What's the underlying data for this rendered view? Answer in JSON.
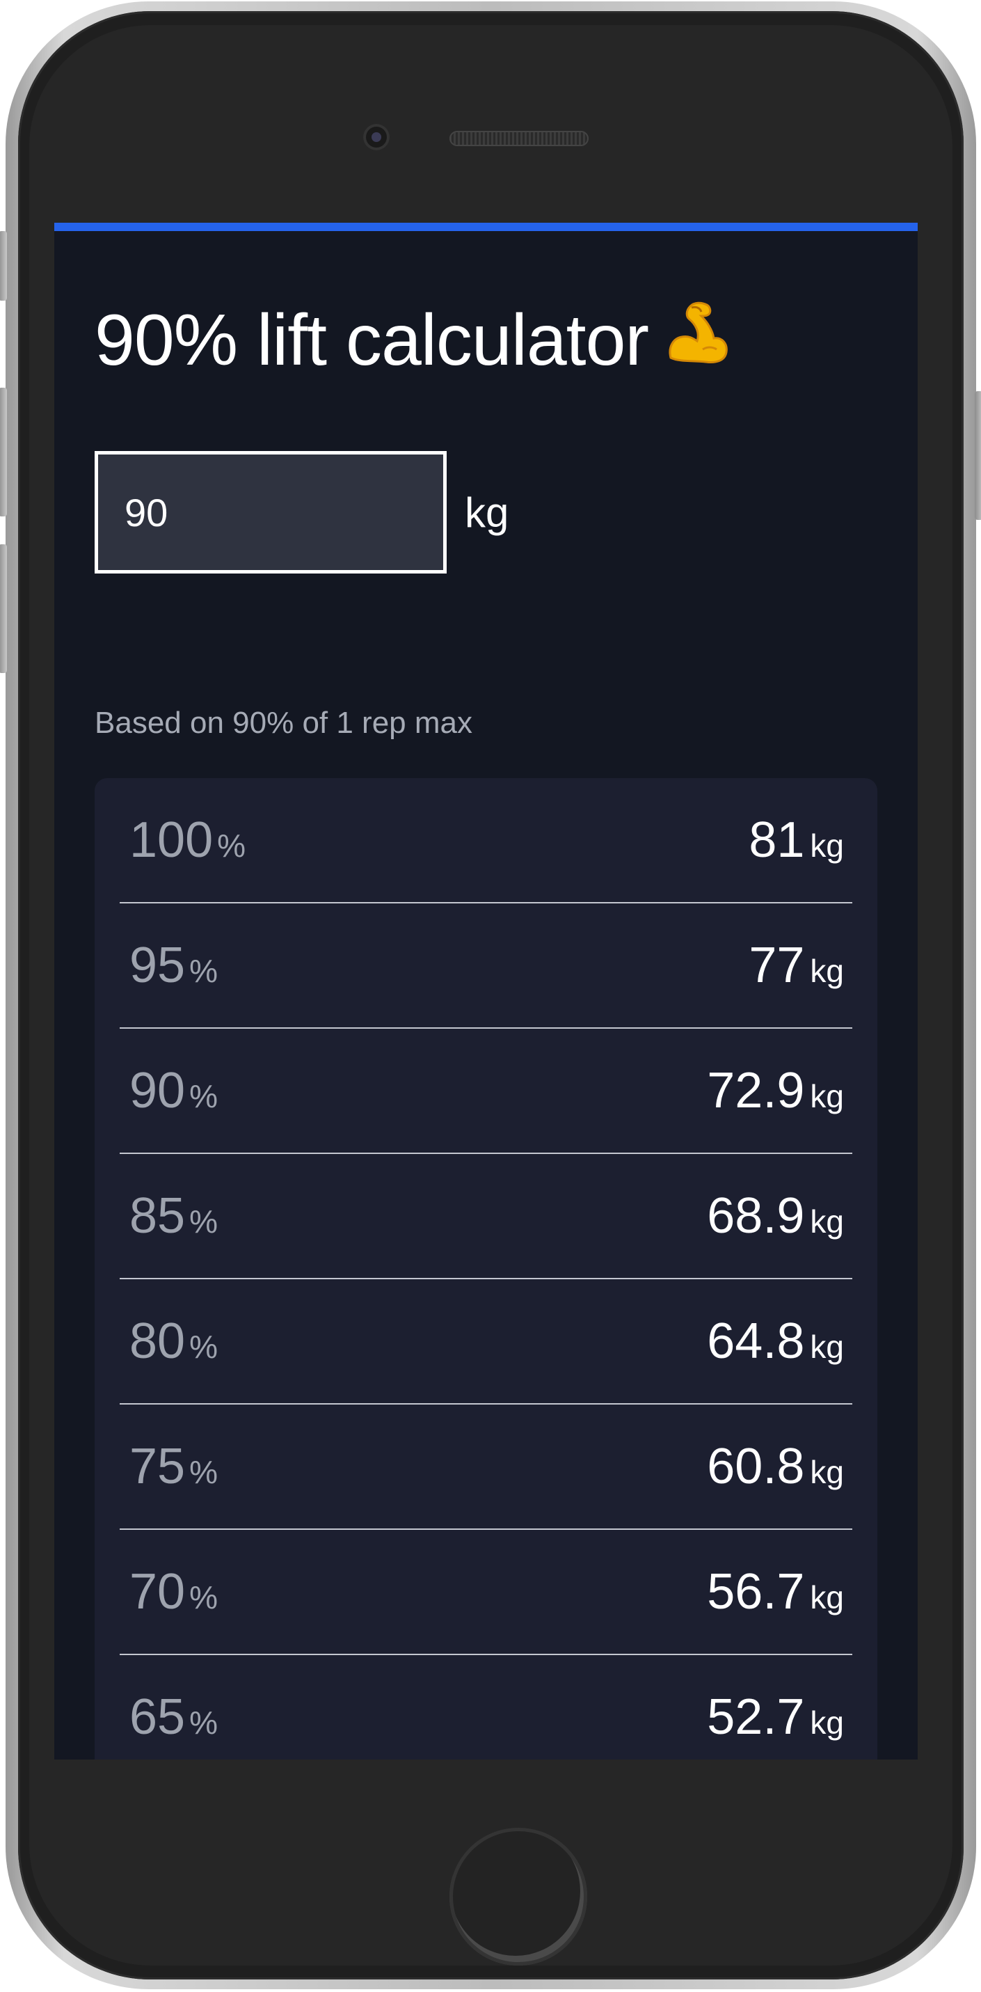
{
  "app": {
    "title": "90% lift calculator",
    "title_emoji": "flexed-biceps-icon",
    "accent_color": "#2563eb",
    "background_color": "#131722"
  },
  "input": {
    "value": "90",
    "unit": "kg"
  },
  "table": {
    "caption": "Based on 90% of 1 rep max",
    "percent_symbol": "%",
    "unit": "kg",
    "rows": [
      {
        "percent": "100",
        "weight": "81"
      },
      {
        "percent": "95",
        "weight": "77"
      },
      {
        "percent": "90",
        "weight": "72.9"
      },
      {
        "percent": "85",
        "weight": "68.9"
      },
      {
        "percent": "80",
        "weight": "64.8"
      },
      {
        "percent": "75",
        "weight": "60.8"
      },
      {
        "percent": "70",
        "weight": "56.7"
      },
      {
        "percent": "65",
        "weight": "52.7"
      }
    ]
  }
}
